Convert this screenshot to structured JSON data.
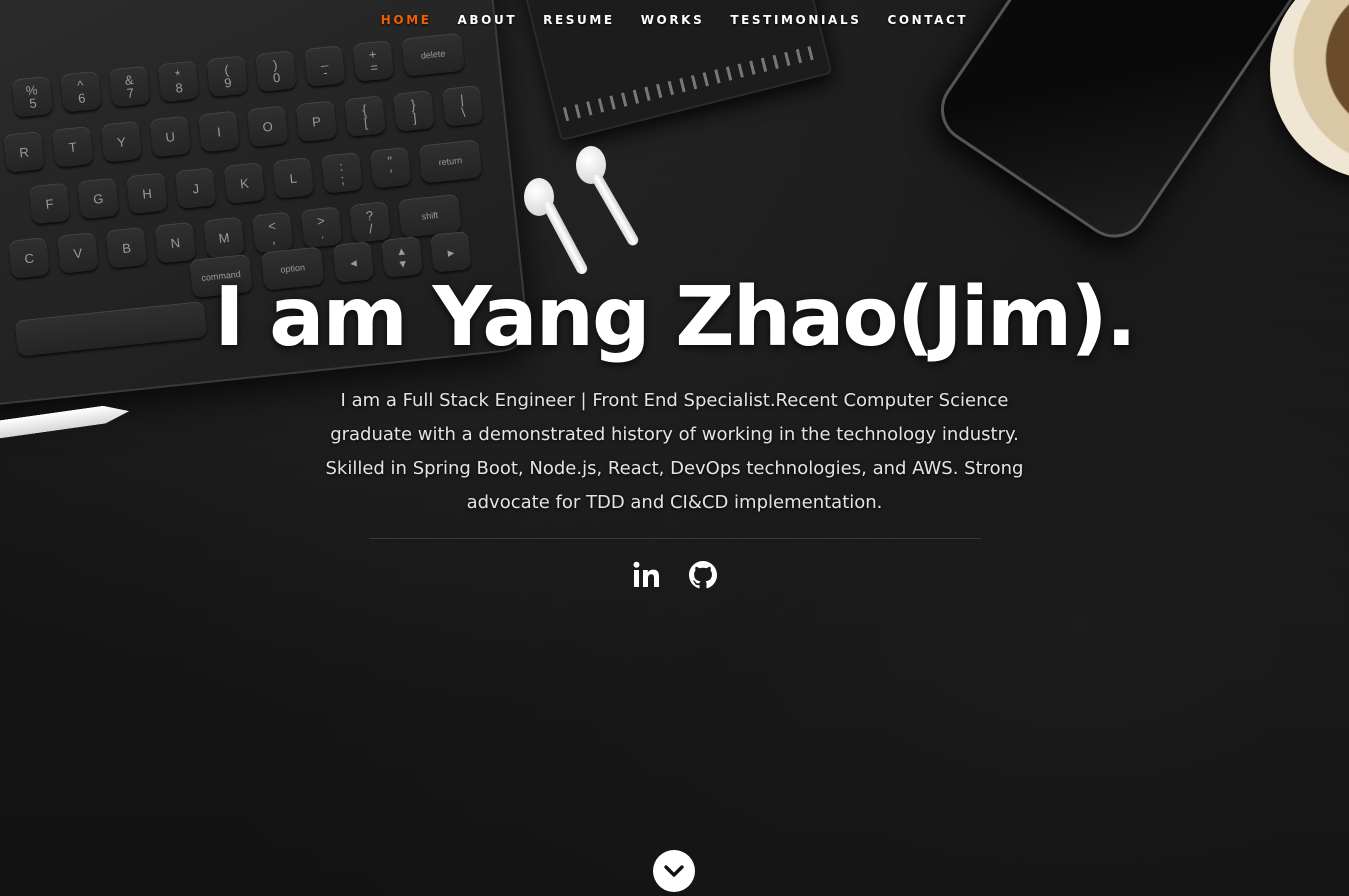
{
  "nav": {
    "items": [
      {
        "label": "Home",
        "current": true
      },
      {
        "label": "About",
        "current": false
      },
      {
        "label": "Resume",
        "current": false
      },
      {
        "label": "Works",
        "current": false
      },
      {
        "label": "Testimonials",
        "current": false
      },
      {
        "label": "Contact",
        "current": false
      }
    ]
  },
  "hero": {
    "headline": "I am Yang Zhao(Jim).",
    "intro": "I am a Full Stack Engineer | Front End Specialist.Recent Computer Science graduate with a demonstrated history of working in the technology industry. Skilled in Spring Boot, Node.js, React, DevOps technologies, and AWS. Strong advocate for TDD and CI&CD implementation."
  },
  "social": [
    {
      "name": "LinkedIn",
      "icon": "linkedin-icon"
    },
    {
      "name": "GitHub",
      "icon": "github-icon"
    }
  ],
  "scroll_down": {
    "icon": "chevron-down-icon"
  },
  "keyboard": {
    "rows": [
      [
        "%\n5",
        "^\n6",
        "&\n7",
        "*\n8",
        "(\n9",
        ")\n0",
        "_\n-",
        "+\n=",
        "delete"
      ],
      [
        "R",
        "T",
        "Y",
        "U",
        "I",
        "O",
        "P",
        "{\n[",
        "}\n]",
        "|\n\\"
      ],
      [
        "F",
        "G",
        "H",
        "J",
        "K",
        "L",
        ":\n;",
        "\"\n'",
        "return"
      ],
      [
        "C",
        "V",
        "B",
        "N",
        "M",
        "<\n,",
        ">\n.",
        "?\n/",
        "shift"
      ],
      [
        "command",
        "option",
        "◂",
        "▴\n▾",
        "▸"
      ]
    ]
  },
  "colors": {
    "accent": "#F06000",
    "background": "#151515",
    "text": "#FFFFFF"
  }
}
